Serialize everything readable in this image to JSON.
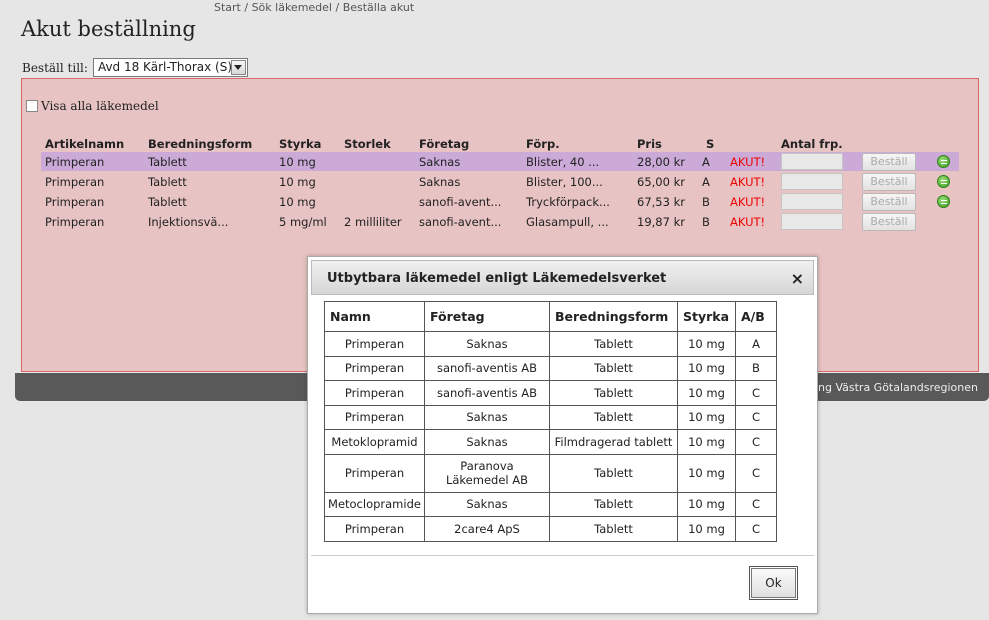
{
  "breadcrumb": {
    "start": "Start",
    "search": "Sök läkemedel",
    "current": "Beställa akut",
    "sep": " / "
  },
  "page": {
    "title": "Akut beställning"
  },
  "order": {
    "label": "Beställ till:",
    "selected": "Avd 18 Kärl-Thorax (S)"
  },
  "visa": {
    "label": "Visa alla läkemedel"
  },
  "table": {
    "headers": {
      "name": "Artikelnamn",
      "form": "Beredningsform",
      "strength": "Styrka",
      "size": "Storlek",
      "company": "Företag",
      "pack": "Förp.",
      "price": "Pris",
      "s": "S",
      "qty": "Antal frp."
    },
    "rows": [
      {
        "name": "Primperan",
        "form": "Tablett",
        "strength": "10 mg",
        "size": "",
        "company": "Saknas",
        "pack": "Blister, 40 ...",
        "price": "28,00 kr",
        "s": "A",
        "akut": "AKUT!",
        "order": "Beställ"
      },
      {
        "name": "Primperan",
        "form": "Tablett",
        "strength": "10 mg",
        "size": "",
        "company": "Saknas",
        "pack": "Blister, 100...",
        "price": "65,00 kr",
        "s": "A",
        "akut": "AKUT!",
        "order": "Beställ"
      },
      {
        "name": "Primperan",
        "form": "Tablett",
        "strength": "10 mg",
        "size": "",
        "company": "sanofi-avent...",
        "pack": "Tryckförpack...",
        "price": "67,53 kr",
        "s": "B",
        "akut": "AKUT!",
        "order": "Beställ"
      },
      {
        "name": "Primperan",
        "form": "Injektionsvä...",
        "strength": "5 mg/ml",
        "size": "2 milliliter",
        "company": "sanofi-avent...",
        "pack": "Glasampull, ...",
        "price": "19,87 kr",
        "s": "B",
        "akut": "AKUT!",
        "order": "Beställ"
      }
    ]
  },
  "footer": {
    "text": "ng Västra Götalandsregionen"
  },
  "dialog": {
    "title": "Utbytbara läkemedel enligt Läkemedelsverket",
    "close": "×",
    "headers": {
      "name": "Namn",
      "company": "Företag",
      "form": "Beredningsform",
      "strength": "Styrka",
      "ab": "A/B"
    },
    "rows": [
      {
        "name": "Primperan",
        "company": "Saknas",
        "form": "Tablett",
        "strength": "10 mg",
        "ab": "A"
      },
      {
        "name": "Primperan",
        "company": "sanofi-aventis AB",
        "form": "Tablett",
        "strength": "10 mg",
        "ab": "B"
      },
      {
        "name": "Primperan",
        "company": "sanofi-aventis AB",
        "form": "Tablett",
        "strength": "10 mg",
        "ab": "C"
      },
      {
        "name": "Primperan",
        "company": "Saknas",
        "form": "Tablett",
        "strength": "10 mg",
        "ab": "C"
      },
      {
        "name": "Metoklopramid",
        "company": "Saknas",
        "form": "Filmdragerad tablett",
        "strength": "10 mg",
        "ab": "C"
      },
      {
        "name": "Primperan",
        "company": "Paranova Läkemedel AB",
        "form": "Tablett",
        "strength": "10 mg",
        "ab": "C"
      },
      {
        "name": "Metoclopramide",
        "company": "Saknas",
        "form": "Tablett",
        "strength": "10 mg",
        "ab": "C"
      },
      {
        "name": "Primperan",
        "company": "2care4 ApS",
        "form": "Tablett",
        "strength": "10 mg",
        "ab": "C"
      }
    ],
    "ok": "Ok"
  },
  "colors": {
    "panel": "#e8c3c3",
    "selected_row": "#cbaad8",
    "akut": "#e00000",
    "footer": "#595959"
  }
}
